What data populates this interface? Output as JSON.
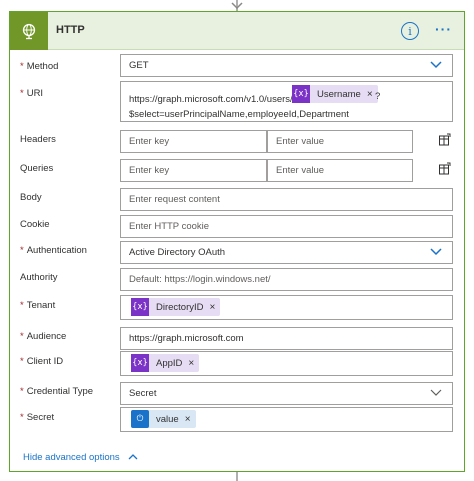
{
  "card": {
    "title": "HTTP",
    "info_glyph": "i",
    "more_glyph": "···",
    "header_bg": "#e8f1df",
    "icon_bg": "#709727",
    "accent": "#1a73c8",
    "token_purple": "#7a32c7"
  },
  "fields": {
    "method": {
      "label": "Method",
      "required": "*",
      "value": "GET"
    },
    "uri": {
      "label": "URI",
      "required": "*",
      "prefix": "https://graph.microsoft.com/v1.0/users/",
      "token": {
        "icon": "{x}",
        "label": "Username",
        "remove": "×"
      },
      "suffix": "?",
      "line2": "$select=userPrincipalName,employeeId,Department"
    },
    "headers": {
      "label": "Headers",
      "key_placeholder": "Enter key",
      "value_placeholder": "Enter value"
    },
    "queries": {
      "label": "Queries",
      "key_placeholder": "Enter key",
      "value_placeholder": "Enter value"
    },
    "body": {
      "label": "Body",
      "placeholder": "Enter request content"
    },
    "cookie": {
      "label": "Cookie",
      "placeholder": "Enter HTTP cookie"
    },
    "authentication": {
      "label": "Authentication",
      "required": "*",
      "value": "Active Directory OAuth"
    },
    "authority": {
      "label": "Authority",
      "placeholder": "Default: https://login.windows.net/"
    },
    "tenant": {
      "label": "Tenant",
      "required": "*",
      "token": {
        "icon": "{x}",
        "label": "DirectoryID",
        "remove": "×"
      }
    },
    "audience": {
      "label": "Audience",
      "required": "*",
      "value": "https://graph.microsoft.com"
    },
    "client_id": {
      "label": "Client ID",
      "required": "*",
      "token": {
        "icon": "{x}",
        "label": "AppID",
        "remove": "×"
      }
    },
    "credential_type": {
      "label": "Credential Type",
      "required": "*",
      "value": "Secret"
    },
    "secret": {
      "label": "Secret",
      "required": "*",
      "token": {
        "icon": "⏻",
        "label": "value",
        "remove": "×"
      }
    }
  },
  "footer": {
    "hide_advanced": "Hide advanced options",
    "chevron": "^"
  }
}
